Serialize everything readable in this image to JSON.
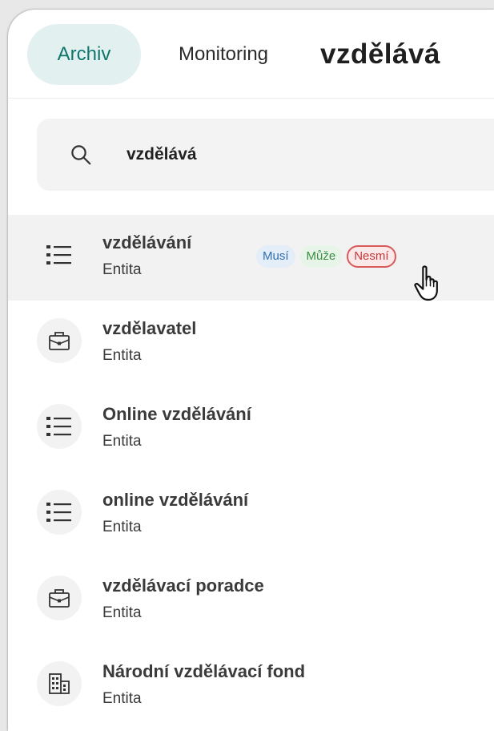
{
  "tabs": {
    "archive_label": "Archiv",
    "monitoring_label": "Monitoring",
    "query_label": "vzdělává"
  },
  "search": {
    "value": "vzdělává",
    "icon": "search-icon"
  },
  "badges": {
    "must": "Musí",
    "may": "Může",
    "must_not": "Nesmí"
  },
  "results": [
    {
      "title": "vzdělávání",
      "type": "Entita",
      "icon": "list-icon"
    },
    {
      "title": "vzdělavatel",
      "type": "Entita",
      "icon": "briefcase-icon"
    },
    {
      "title": "Online vzdělávání",
      "type": "Entita",
      "icon": "list-icon"
    },
    {
      "title": "online vzdělávání",
      "type": "Entita",
      "icon": "list-icon"
    },
    {
      "title": "vzdělávací poradce",
      "type": "Entita",
      "icon": "briefcase-icon"
    },
    {
      "title": "Národní vzdělávací fond",
      "type": "Entita",
      "icon": "building-icon"
    }
  ],
  "colors": {
    "accent": "#0f766e",
    "must": "#2f6fb0",
    "may": "#3c8f44",
    "must_not": "#c23a3a"
  }
}
